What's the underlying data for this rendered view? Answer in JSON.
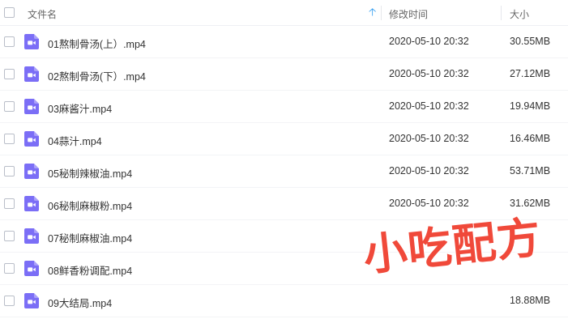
{
  "header": {
    "name_label": "文件名",
    "sort_icon": "arrow-up-icon",
    "time_label": "修改时间",
    "size_label": "大小"
  },
  "file_icon": "video-file-icon",
  "colors": {
    "accent": "#2e9bf0",
    "file_icon": "#7b6ef6",
    "watermark": "#f0493a"
  },
  "files": [
    {
      "name": "01熬制骨汤(上）.mp4",
      "time": "2020-05-10 20:32",
      "size": "30.55MB"
    },
    {
      "name": "02熬制骨汤(下）.mp4",
      "time": "2020-05-10 20:32",
      "size": "27.12MB"
    },
    {
      "name": "03麻酱汁.mp4",
      "time": "2020-05-10 20:32",
      "size": "19.94MB"
    },
    {
      "name": "04蒜汁.mp4",
      "time": "2020-05-10 20:32",
      "size": "16.46MB"
    },
    {
      "name": "05秘制辣椒油.mp4",
      "time": "2020-05-10 20:32",
      "size": "53.71MB"
    },
    {
      "name": "06秘制麻椒粉.mp4",
      "time": "2020-05-10 20:32",
      "size": "31.62MB"
    },
    {
      "name": "07秘制麻椒油.mp4",
      "time": "",
      "size": ""
    },
    {
      "name": "08鲜香粉调配.mp4",
      "time": "",
      "size": ""
    },
    {
      "name": "09大结局.mp4",
      "time": "",
      "size": "18.88MB"
    }
  ],
  "watermark": "小吃配方"
}
